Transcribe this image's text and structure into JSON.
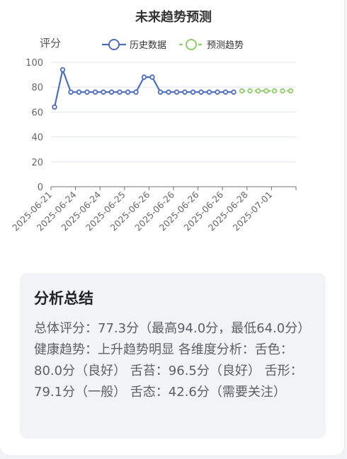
{
  "page": {
    "title": "未来趋势预测"
  },
  "chart_data": {
    "type": "line",
    "title": "未来趋势预测",
    "ylabel": "评分",
    "xlabel": "",
    "ylim": [
      0,
      100
    ],
    "yticks": [
      0,
      20,
      40,
      60,
      80,
      100
    ],
    "grid": true,
    "legend_position": "top",
    "x_tick_labels": [
      "2025-06-21",
      "2025-06-24",
      "2025-06-24",
      "2025-06-25",
      "2025-06-26",
      "2025-06-26",
      "2025-06-26",
      "2025-06-26",
      "2025-06-28",
      "2025-07-01"
    ],
    "series": [
      {
        "name": "历史数据",
        "color": "#4e6db8",
        "values": [
          64,
          94,
          76,
          76,
          76,
          76,
          76,
          76,
          76,
          76,
          76,
          88,
          88,
          76,
          76,
          76,
          76,
          76,
          76,
          76,
          76,
          76,
          76
        ]
      },
      {
        "name": "预测趋势",
        "color": "#8fcb6b",
        "values": [
          77,
          77,
          77,
          77,
          77,
          77,
          77
        ]
      }
    ]
  },
  "summary": {
    "title": "分析总结",
    "text": "总体评分：77.3分（最高94.0分，最低64.0分） 健康趋势：上升趋势明显 各维度分析：舌色：80.0分（良好） 舌苔：96.5分（良好） 舌形：79.1分（一般） 舌态：42.6分（需要关注）"
  }
}
